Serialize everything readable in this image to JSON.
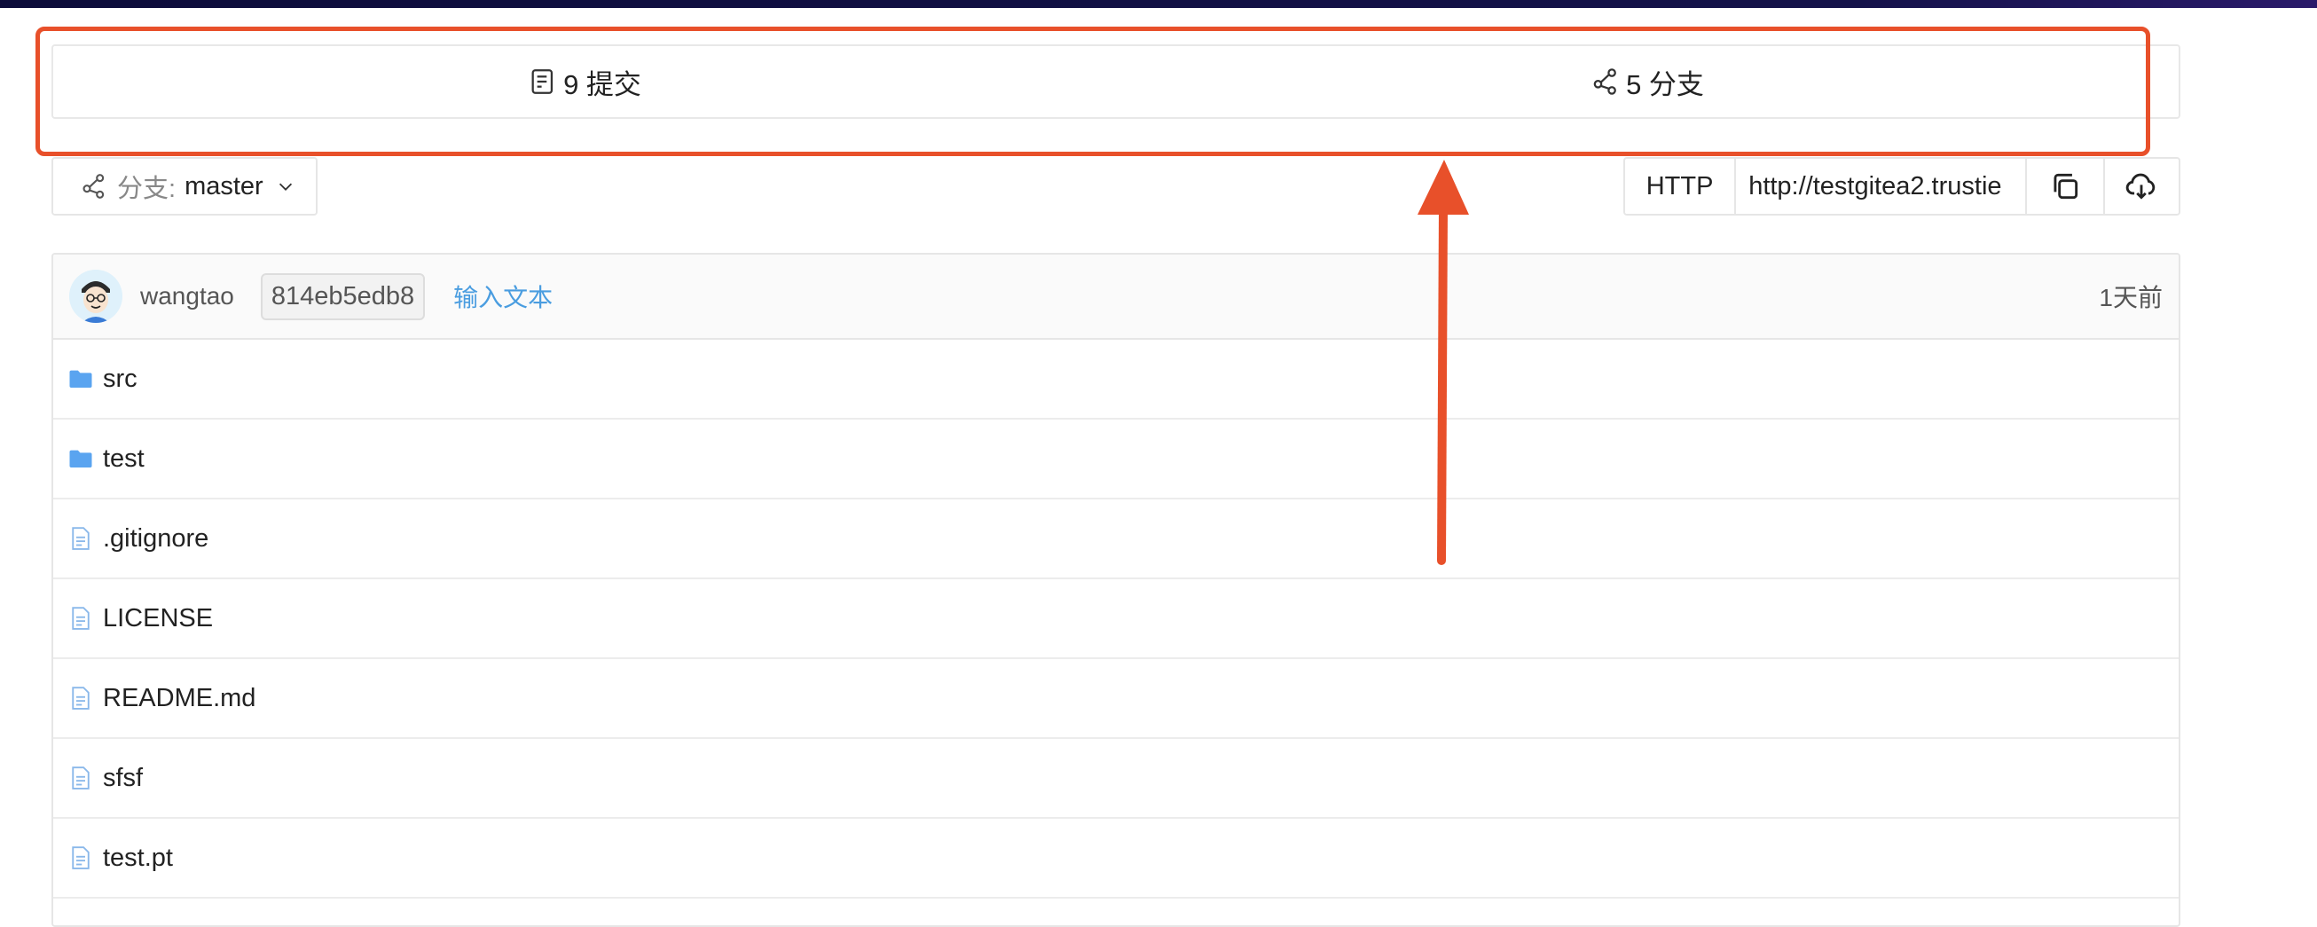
{
  "summary": {
    "commits_label": "9 提交",
    "branches_label": "5 分支"
  },
  "branch_selector": {
    "prefix": "分支:",
    "value": "master"
  },
  "clone": {
    "protocol": "HTTP",
    "url": "http://testgitea2.trustie"
  },
  "latest_commit": {
    "author": "wangtao",
    "sha": "814eb5edb8",
    "message": "输入文本",
    "time": "1天前"
  },
  "files": [
    {
      "name": "src",
      "type": "folder"
    },
    {
      "name": "test",
      "type": "folder"
    },
    {
      "name": ".gitignore",
      "type": "file"
    },
    {
      "name": "LICENSE",
      "type": "file"
    },
    {
      "name": "README.md",
      "type": "file"
    },
    {
      "name": "sfsf",
      "type": "file"
    },
    {
      "name": "test.pt",
      "type": "file"
    }
  ],
  "colors": {
    "highlight": "#e8502a",
    "link": "#4a9de0",
    "folder": "#5aa4f0"
  }
}
